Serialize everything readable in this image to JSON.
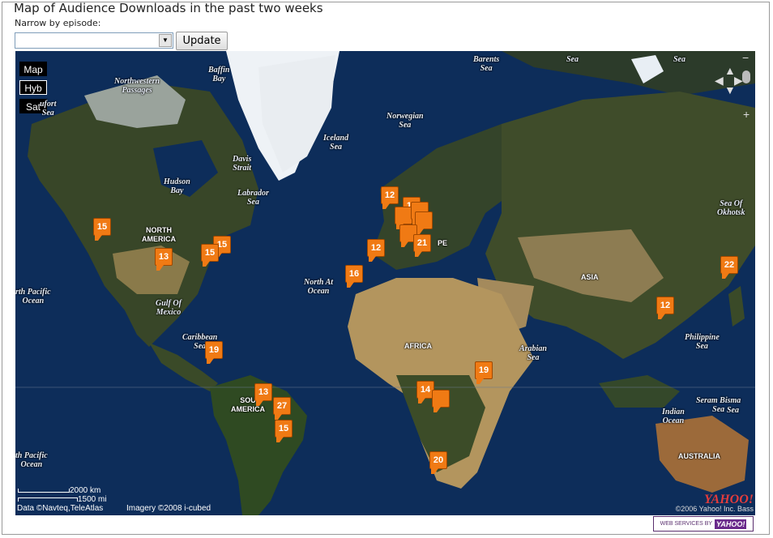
{
  "header": {
    "title": "Map of Audience Downloads in the past two weeks",
    "narrow_label": "Narrow by episode:",
    "episode_value": "",
    "update_label": "Update"
  },
  "map_types": {
    "map": "Map",
    "hyb": "Hyb",
    "sat": "Sat",
    "active": "Hyb"
  },
  "labels": {
    "northwestern": "Northwestern\nPassages",
    "baffin": "Baffin\nBay",
    "beaufort": "ufort\nSea",
    "davis": "Davis\nStrait",
    "hudson": "Hudson\nBay",
    "labrador": "Labrador\nSea",
    "iceland": "Iceland\nSea",
    "norwegian": "Norwegian\nSea",
    "barents": "Barents\nSea",
    "sea_top1": "Sea",
    "sea_top2": "Sea",
    "north_america": "NORTH\nAMERICA",
    "north_pacific": "rth Pacific\nOcean",
    "gulf": "Gulf Of\nMexico",
    "caribbean": "Caribbean\nSea",
    "north_atlantic": "North At\nOcean",
    "europe": "PE",
    "asia": "ASIA",
    "africa": "AFRICA",
    "arabian": "Arabian\nSea",
    "philippine": "Philippine\nSea",
    "okhotsk": "Sea Of\nOkhotsk",
    "south_america": "SOU\nAMERICA",
    "south_pacific": "th Pacific\nOcean",
    "indian": "Indian\nOcean",
    "seram": "Seram Bisma\nSea",
    "sea_right": "Sea",
    "australia": "AUSTRALIA"
  },
  "markers": [
    {
      "label": "15"
    },
    {
      "label": "15"
    },
    {
      "label": "15"
    },
    {
      "label": "13"
    },
    {
      "label": "19"
    },
    {
      "label": "13"
    },
    {
      "label": "27"
    },
    {
      "label": "15"
    },
    {
      "label": "12"
    },
    {
      "label": "12"
    },
    {
      "label": ""
    },
    {
      "label": ""
    },
    {
      "label": ""
    },
    {
      "label": ""
    },
    {
      "label": "12"
    },
    {
      "label": "16"
    },
    {
      "label": "21"
    },
    {
      "label": "14"
    },
    {
      "label": ""
    },
    {
      "label": "19"
    },
    {
      "label": "20"
    },
    {
      "label": "12"
    },
    {
      "label": "22"
    }
  ],
  "scale": {
    "km": "2000 km",
    "mi": "1500 mi"
  },
  "credits": {
    "data": "Data ©Navteq,TeleAtlas",
    "imagery": "Imagery ©2008 i-cubed",
    "yahoo_logo": "YAHOO!",
    "copyright": "©2006 Yahoo! Inc.",
    "basso": "Bass"
  },
  "badge": {
    "text": "WEB SERVICES BY",
    "brand": "YAHOO!"
  },
  "colors": {
    "marker": "#f07a14",
    "ocean": "#0b2a55",
    "land": "#3d4a25"
  }
}
